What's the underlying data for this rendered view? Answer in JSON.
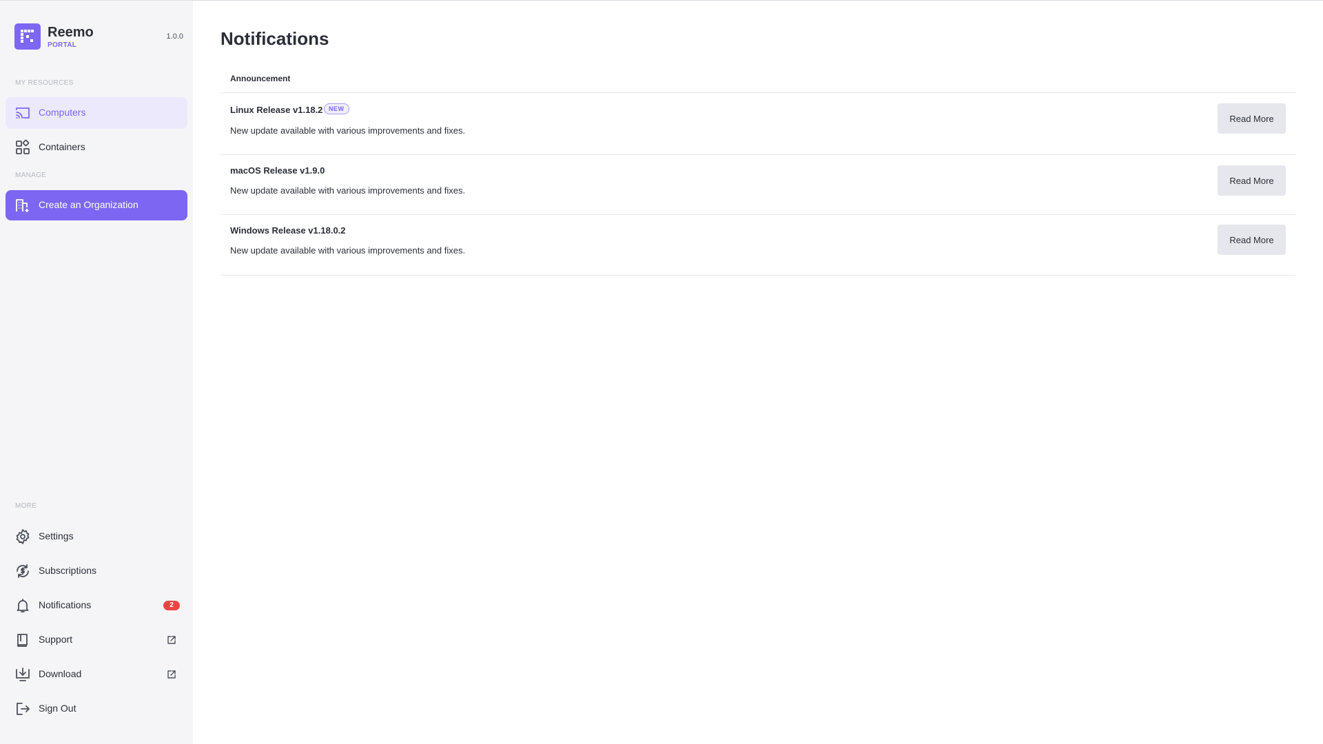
{
  "brand": {
    "name": "Reemo",
    "subtitle": "PORTAL",
    "version": "1.0.0",
    "accent": "#7c66f2"
  },
  "sidebar": {
    "sections": {
      "resources": "MY RESOURCES",
      "manage": "MANAGE",
      "more": "MORE"
    },
    "resources": [
      {
        "label": "Computers",
        "icon": "monitor-cast-icon",
        "active": true
      },
      {
        "label": "Containers",
        "icon": "grid-apps-icon"
      }
    ],
    "manage": [
      {
        "label": "Create an Organization",
        "icon": "building-add-icon"
      }
    ],
    "more": [
      {
        "label": "Settings",
        "icon": "gear-icon"
      },
      {
        "label": "Subscriptions",
        "icon": "refresh-dollar-icon"
      },
      {
        "label": "Notifications",
        "icon": "bell-icon",
        "badge": "2"
      },
      {
        "label": "Support",
        "icon": "book-icon",
        "external": true
      },
      {
        "label": "Download",
        "icon": "download-icon",
        "external": true
      },
      {
        "label": "Sign Out",
        "icon": "sign-out-icon"
      }
    ]
  },
  "main": {
    "title": "Notifications",
    "table": {
      "header": "Announcement",
      "rows": [
        {
          "title": "Linux Release v1.18.2",
          "badge": "NEW",
          "description": "New update available with various improvements and fixes.",
          "button": "Read More"
        },
        {
          "title": "macOS Release v1.9.0",
          "description": "New update available with various improvements and fixes.",
          "button": "Read More"
        },
        {
          "title": "Windows Release v1.18.0.2",
          "description": "New update available with various improvements and fixes.",
          "button": "Read More"
        }
      ]
    }
  }
}
